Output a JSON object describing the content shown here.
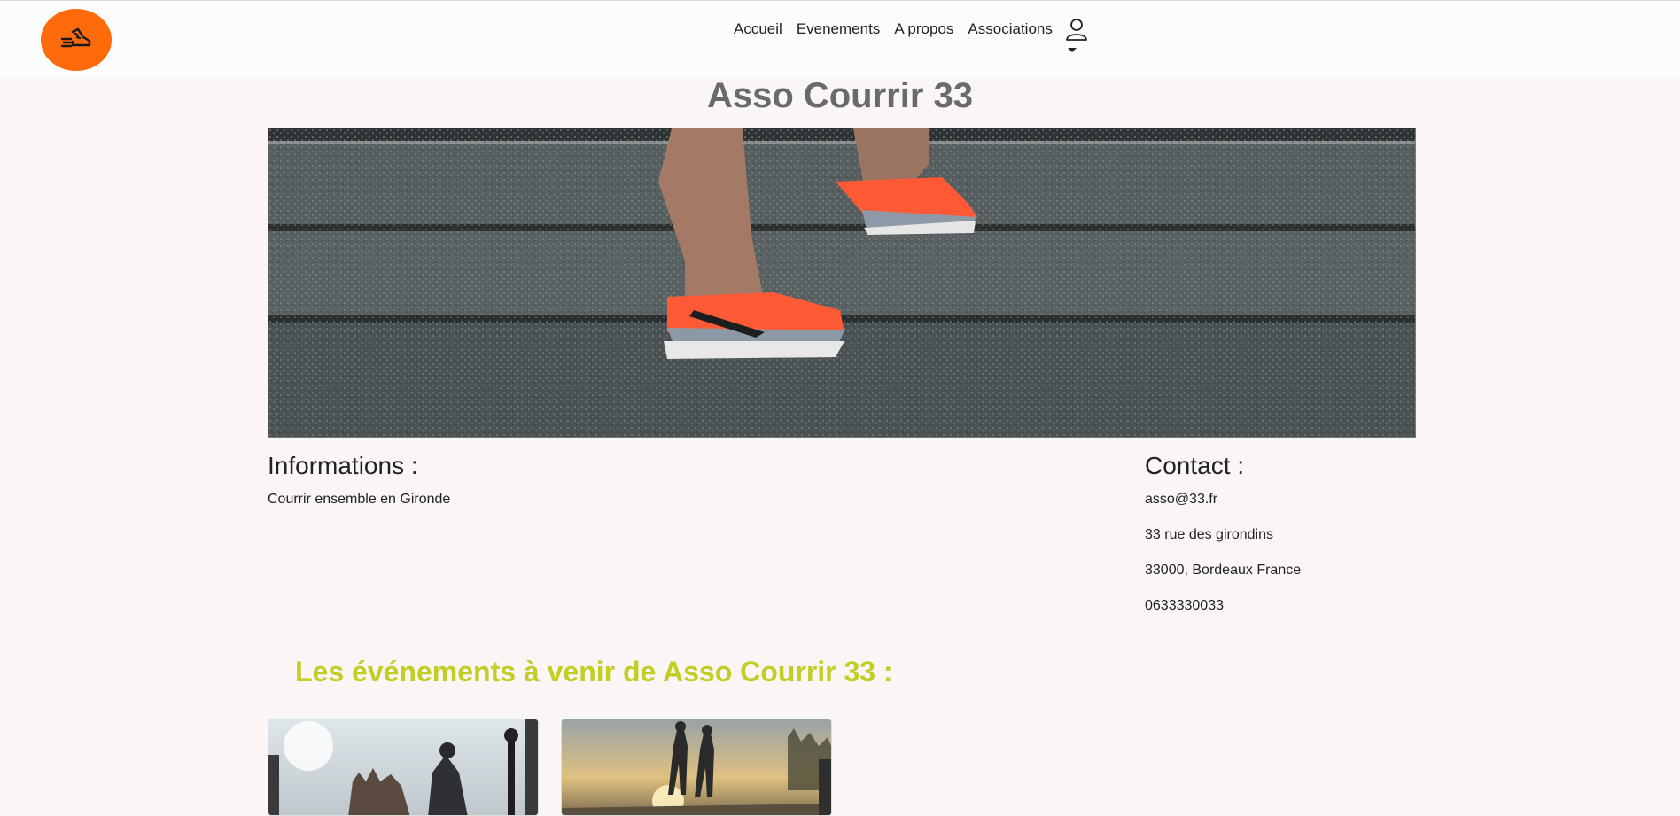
{
  "nav": {
    "links": [
      "Accueil",
      "Evenements",
      "A propos",
      "Associations"
    ]
  },
  "page": {
    "title": "Asso Courrir 33"
  },
  "informations": {
    "heading": "Informations :",
    "text": "Courrir ensemble en Gironde"
  },
  "contact": {
    "heading": "Contact :",
    "email": "asso@33.fr",
    "street": "33 rue des girondins",
    "city": "33000, Bordeaux France",
    "phone": "0633330033"
  },
  "events": {
    "heading": "Les événements à venir de Asso Courrir 33 :"
  },
  "colors": {
    "brand": "#ff6a0a",
    "accent": "#c3cd26"
  },
  "icons": [
    "running-shoe-logo-icon",
    "user-icon",
    "caret-down-icon"
  ]
}
